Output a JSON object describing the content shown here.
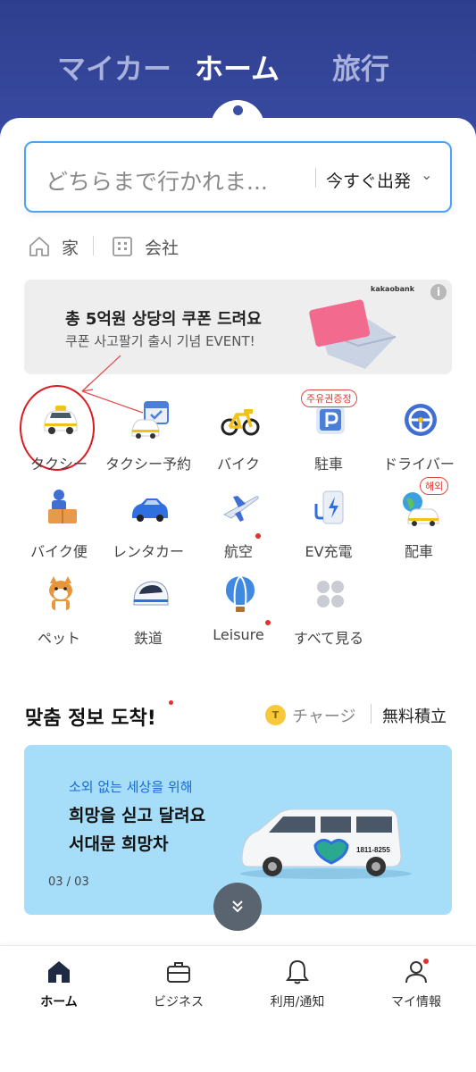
{
  "header": {
    "tabs": [
      {
        "label": "マイカー",
        "active": false
      },
      {
        "label": "ホーム",
        "active": true
      },
      {
        "label": "旅行",
        "active": false
      }
    ]
  },
  "search": {
    "placeholder": "どちらまで行かれま...",
    "depart_label": "今すぐ出発"
  },
  "places": [
    {
      "label": "家",
      "icon": "home-icon"
    },
    {
      "label": "会社",
      "icon": "building-icon"
    }
  ],
  "banner": {
    "title": "총 5억원 상당의 쿠폰 드려요",
    "subtitle": "쿠폰 사고팔기 출시 기념 EVENT!",
    "brand": "kakaobank",
    "info": "i"
  },
  "services": [
    {
      "label": "タクシー",
      "icon": "taxi-icon"
    },
    {
      "label": "タクシー予約",
      "icon": "taxi-reservation-icon"
    },
    {
      "label": "バイク",
      "icon": "bike-icon"
    },
    {
      "label": "駐車",
      "icon": "parking-icon",
      "badge": "주유권증정"
    },
    {
      "label": "ドライバー",
      "icon": "driver-icon"
    },
    {
      "label": "バイク便",
      "icon": "bike-delivery-icon"
    },
    {
      "label": "レンタカー",
      "icon": "rental-car-icon"
    },
    {
      "label": "航空",
      "icon": "airplane-icon",
      "dot": true
    },
    {
      "label": "EV充電",
      "icon": "ev-charger-icon"
    },
    {
      "label": "配車",
      "icon": "global-car-icon",
      "badge": "해외"
    },
    {
      "label": "ペット",
      "icon": "pet-icon"
    },
    {
      "label": "鉄道",
      "icon": "train-icon"
    },
    {
      "label": "Leisure",
      "icon": "balloon-icon",
      "dot": true
    },
    {
      "label": "すべて見る",
      "icon": "all-grid-icon"
    }
  ],
  "recommend": {
    "title": "맞춤 정보 도착!",
    "coin": "T",
    "charge": "チャージ",
    "free": "無料積立"
  },
  "card": {
    "subtitle": "소외 없는 세상을 위해",
    "line1": "희망을 싣고 달려요",
    "line2": "서대문 희망차",
    "page": "03 / 03",
    "van_phone": "1811-8255"
  },
  "bottom_nav": [
    {
      "label": "ホーム",
      "icon": "home-icon",
      "active": true
    },
    {
      "label": "ビジネス",
      "icon": "briefcase-icon"
    },
    {
      "label": "利用/通知",
      "icon": "bell-icon"
    },
    {
      "label": "マイ情報",
      "icon": "person-icon",
      "dot": true
    }
  ],
  "colors": {
    "header": "#3b4ea6",
    "search_border": "#4aa3f5",
    "accent_red": "#e5302a",
    "card_bg": "#a6defa"
  }
}
